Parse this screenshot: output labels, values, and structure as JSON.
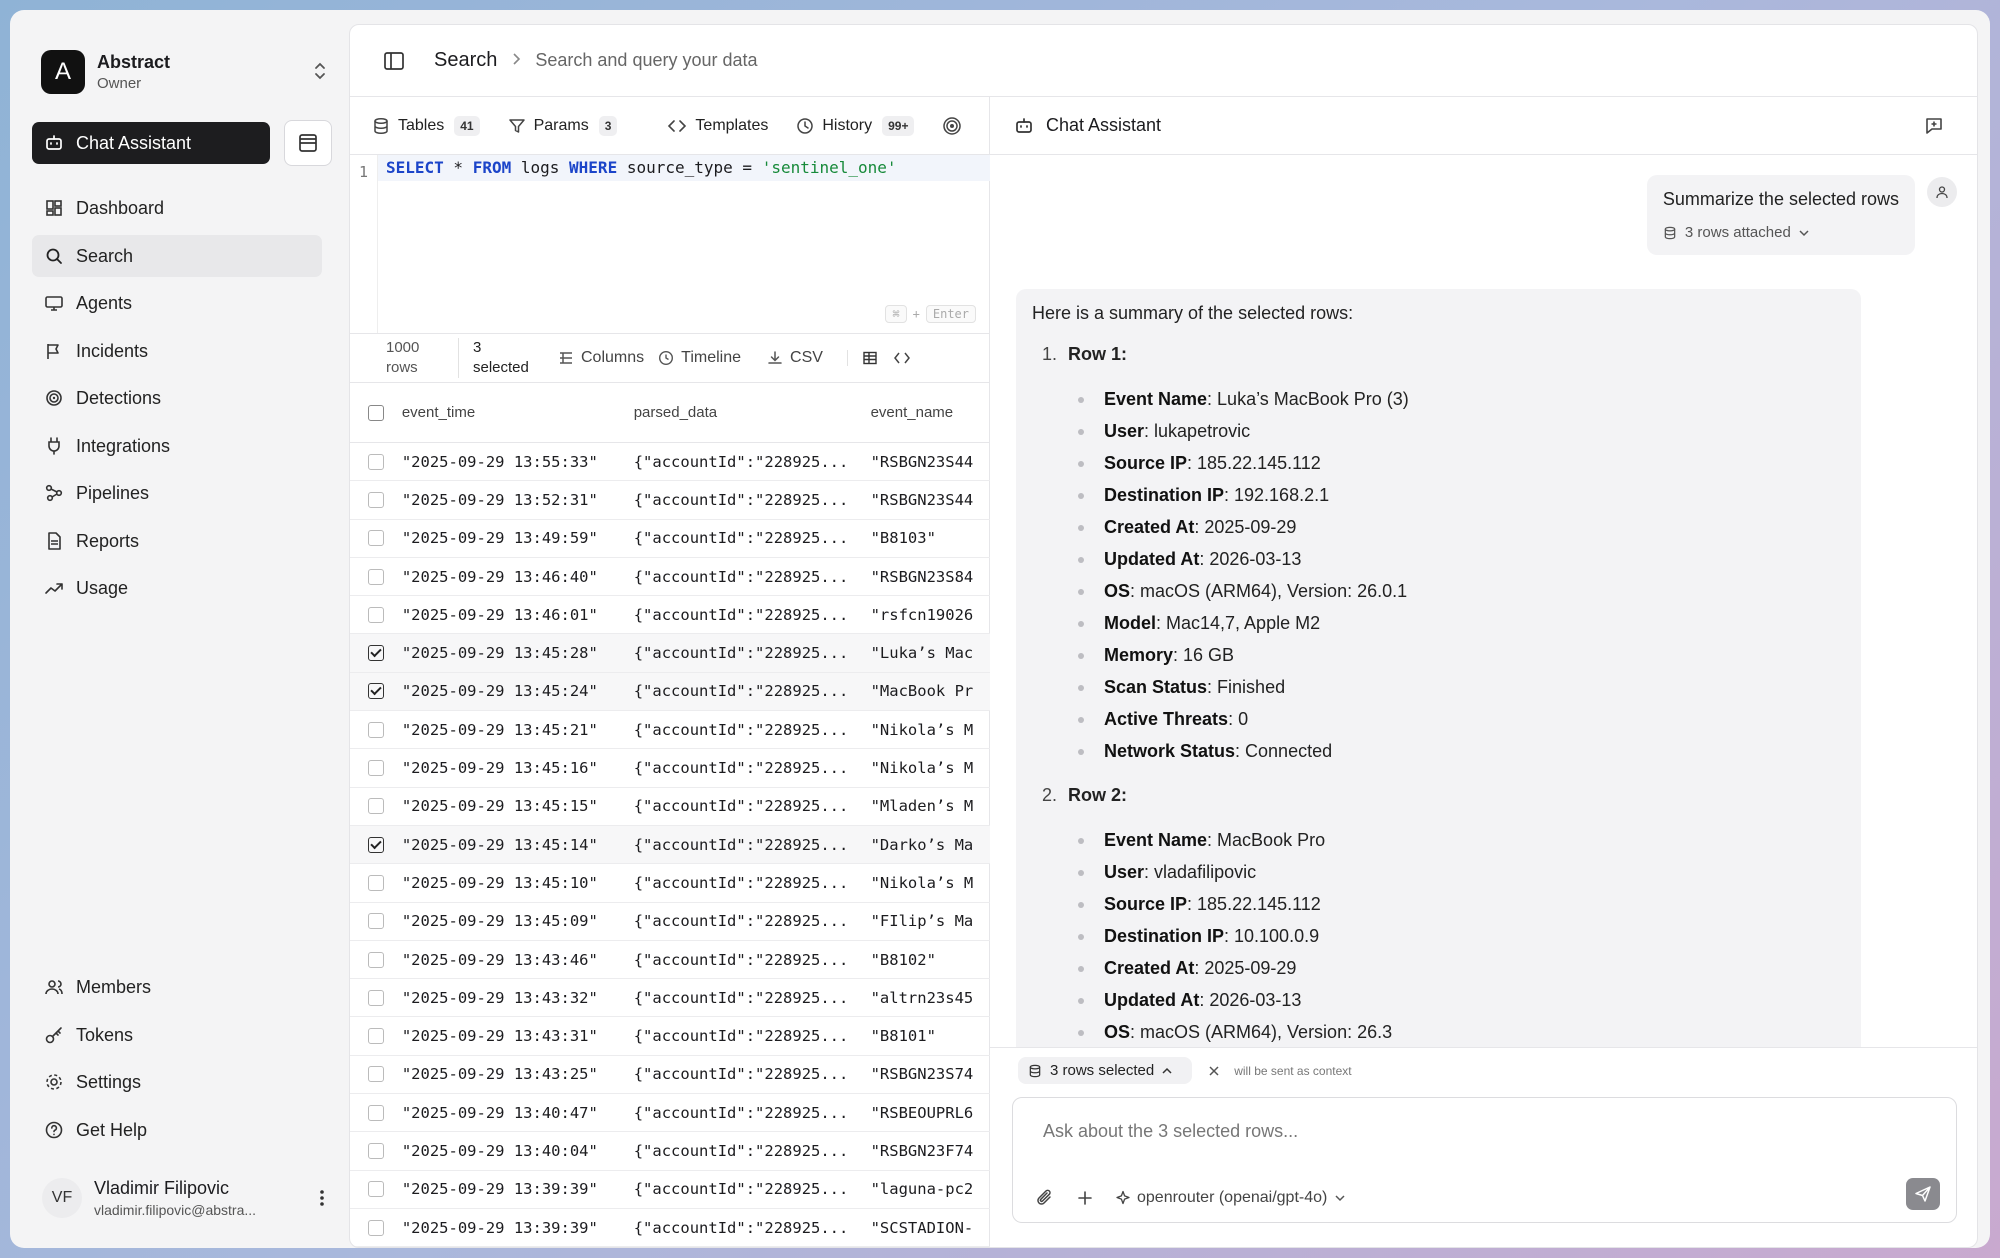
{
  "workspace": {
    "initial": "A",
    "name": "Abstract",
    "role": "Owner"
  },
  "sidebar": {
    "chat_label": "Chat Assistant",
    "items": [
      {
        "label": "Dashboard",
        "icon": "dashboard-icon"
      },
      {
        "label": "Search",
        "icon": "search-icon",
        "active": true
      },
      {
        "label": "Agents",
        "icon": "monitor-icon"
      },
      {
        "label": "Incidents",
        "icon": "flag-icon"
      },
      {
        "label": "Detections",
        "icon": "radar-icon"
      },
      {
        "label": "Integrations",
        "icon": "plug-icon"
      },
      {
        "label": "Pipelines",
        "icon": "workflow-icon"
      },
      {
        "label": "Reports",
        "icon": "file-icon"
      },
      {
        "label": "Usage",
        "icon": "trend-icon"
      }
    ],
    "bottom_items": [
      {
        "label": "Members",
        "icon": "users-icon"
      },
      {
        "label": "Tokens",
        "icon": "key-icon"
      },
      {
        "label": "Settings",
        "icon": "gear-icon"
      },
      {
        "label": "Get Help",
        "icon": "help-icon"
      }
    ],
    "user": {
      "initials": "VF",
      "name": "Vladimir Filipovic",
      "email": "vladimir.filipovic@abstra..."
    }
  },
  "header": {
    "crumb": "Search",
    "subtitle": "Search and query your data"
  },
  "query_toolbar": {
    "tables_label": "Tables",
    "tables_count": "41",
    "params_label": "Params",
    "params_count": "3",
    "templates_label": "Templates",
    "history_label": "History",
    "history_count": "99+"
  },
  "editor": {
    "line_number": "1",
    "tokens": {
      "select": "SELECT",
      "star": " * ",
      "from": "FROM",
      "table": " logs ",
      "where": "WHERE",
      "cond": " source_type = ",
      "value": "'sentinel_one'"
    },
    "hint_key": "⌘",
    "hint_plus": "+",
    "hint_enter": "Enter"
  },
  "results_toolbar": {
    "rows_count": "1000",
    "rows_label": "rows",
    "selected_count": "3",
    "selected_label": "selected",
    "columns_label": "Columns",
    "timeline_label": "Timeline",
    "csv_label": "CSV"
  },
  "table": {
    "columns": [
      "event_time",
      "parsed_data",
      "event_name"
    ],
    "rows": [
      {
        "selected": false,
        "event_time": "\"2025-09-29 13:55:33\"",
        "parsed_data": "{\"accountId\":\"228925...",
        "event_name": "\"RSBGN23S44"
      },
      {
        "selected": false,
        "event_time": "\"2025-09-29 13:52:31\"",
        "parsed_data": "{\"accountId\":\"228925...",
        "event_name": "\"RSBGN23S44"
      },
      {
        "selected": false,
        "event_time": "\"2025-09-29 13:49:59\"",
        "parsed_data": "{\"accountId\":\"228925...",
        "event_name": "\"B8103\""
      },
      {
        "selected": false,
        "event_time": "\"2025-09-29 13:46:40\"",
        "parsed_data": "{\"accountId\":\"228925...",
        "event_name": "\"RSBGN23S84"
      },
      {
        "selected": false,
        "event_time": "\"2025-09-29 13:46:01\"",
        "parsed_data": "{\"accountId\":\"228925...",
        "event_name": "\"rsfcn19026"
      },
      {
        "selected": true,
        "event_time": "\"2025-09-29 13:45:28\"",
        "parsed_data": "{\"accountId\":\"228925...",
        "event_name": "\"Luka’s Mac"
      },
      {
        "selected": true,
        "event_time": "\"2025-09-29 13:45:24\"",
        "parsed_data": "{\"accountId\":\"228925...",
        "event_name": "\"MacBook Pr"
      },
      {
        "selected": false,
        "event_time": "\"2025-09-29 13:45:21\"",
        "parsed_data": "{\"accountId\":\"228925...",
        "event_name": "\"Nikola’s M"
      },
      {
        "selected": false,
        "event_time": "\"2025-09-29 13:45:16\"",
        "parsed_data": "{\"accountId\":\"228925...",
        "event_name": "\"Nikola’s M"
      },
      {
        "selected": false,
        "event_time": "\"2025-09-29 13:45:15\"",
        "parsed_data": "{\"accountId\":\"228925...",
        "event_name": "\"Mladen’s M"
      },
      {
        "selected": true,
        "event_time": "\"2025-09-29 13:45:14\"",
        "parsed_data": "{\"accountId\":\"228925...",
        "event_name": "\"Darko’s Ma"
      },
      {
        "selected": false,
        "event_time": "\"2025-09-29 13:45:10\"",
        "parsed_data": "{\"accountId\":\"228925...",
        "event_name": "\"Nikola’s M"
      },
      {
        "selected": false,
        "event_time": "\"2025-09-29 13:45:09\"",
        "parsed_data": "{\"accountId\":\"228925...",
        "event_name": "\"FIlip’s Ma"
      },
      {
        "selected": false,
        "event_time": "\"2025-09-29 13:43:46\"",
        "parsed_data": "{\"accountId\":\"228925...",
        "event_name": "\"B8102\""
      },
      {
        "selected": false,
        "event_time": "\"2025-09-29 13:43:32\"",
        "parsed_data": "{\"accountId\":\"228925...",
        "event_name": "\"altrn23s45"
      },
      {
        "selected": false,
        "event_time": "\"2025-09-29 13:43:31\"",
        "parsed_data": "{\"accountId\":\"228925...",
        "event_name": "\"B8101\""
      },
      {
        "selected": false,
        "event_time": "\"2025-09-29 13:43:25\"",
        "parsed_data": "{\"accountId\":\"228925...",
        "event_name": "\"RSBGN23S74"
      },
      {
        "selected": false,
        "event_time": "\"2025-09-29 13:40:47\"",
        "parsed_data": "{\"accountId\":\"228925...",
        "event_name": "\"RSBEOUPRL6"
      },
      {
        "selected": false,
        "event_time": "\"2025-09-29 13:40:04\"",
        "parsed_data": "{\"accountId\":\"228925...",
        "event_name": "\"RSBGN23F74"
      },
      {
        "selected": false,
        "event_time": "\"2025-09-29 13:39:39\"",
        "parsed_data": "{\"accountId\":\"228925...",
        "event_name": "\"laguna-pc2"
      },
      {
        "selected": false,
        "event_time": "\"2025-09-29 13:39:39\"",
        "parsed_data": "{\"accountId\":\"228925...",
        "event_name": "\"SCSTADION-"
      }
    ]
  },
  "chat": {
    "title": "Chat Assistant",
    "user_message": "Summarize the selected rows",
    "attachment_label": "3 rows attached",
    "assistant_intro": "Here is a summary of the selected rows:",
    "rows": [
      {
        "num": "1.",
        "title": "Row 1:",
        "facts": [
          {
            "k": "Event Name",
            "v": ": Luka’s MacBook Pro (3)"
          },
          {
            "k": "User",
            "v": ": lukapetrovic"
          },
          {
            "k": "Source IP",
            "v": ": 185.22.145.112"
          },
          {
            "k": "Destination IP",
            "v": ": 192.168.2.1"
          },
          {
            "k": "Created At",
            "v": ": 2025-09-29"
          },
          {
            "k": "Updated At",
            "v": ": 2026-03-13"
          },
          {
            "k": "OS",
            "v": ": macOS (ARM64), Version: 26.0.1"
          },
          {
            "k": "Model",
            "v": ": Mac14,7, Apple M2"
          },
          {
            "k": "Memory",
            "v": ": 16 GB"
          },
          {
            "k": "Scan Status",
            "v": ": Finished"
          },
          {
            "k": "Active Threats",
            "v": ": 0"
          },
          {
            "k": "Network Status",
            "v": ": Connected"
          }
        ]
      },
      {
        "num": "2.",
        "title": "Row 2:",
        "facts": [
          {
            "k": "Event Name",
            "v": ": MacBook Pro"
          },
          {
            "k": "User",
            "v": ": vladafilipovic"
          },
          {
            "k": "Source IP",
            "v": ": 185.22.145.112"
          },
          {
            "k": "Destination IP",
            "v": ": 10.100.0.9"
          },
          {
            "k": "Created At",
            "v": ": 2025-09-29"
          },
          {
            "k": "Updated At",
            "v": ": 2026-03-13"
          },
          {
            "k": "OS",
            "v": ": macOS (ARM64), Version: 26.3"
          }
        ]
      }
    ],
    "context_chip": "3 rows selected",
    "context_note": "will be sent as context",
    "input_placeholder": "Ask about the 3 selected rows...",
    "model_label": "openrouter (openai/gpt-4o)"
  }
}
